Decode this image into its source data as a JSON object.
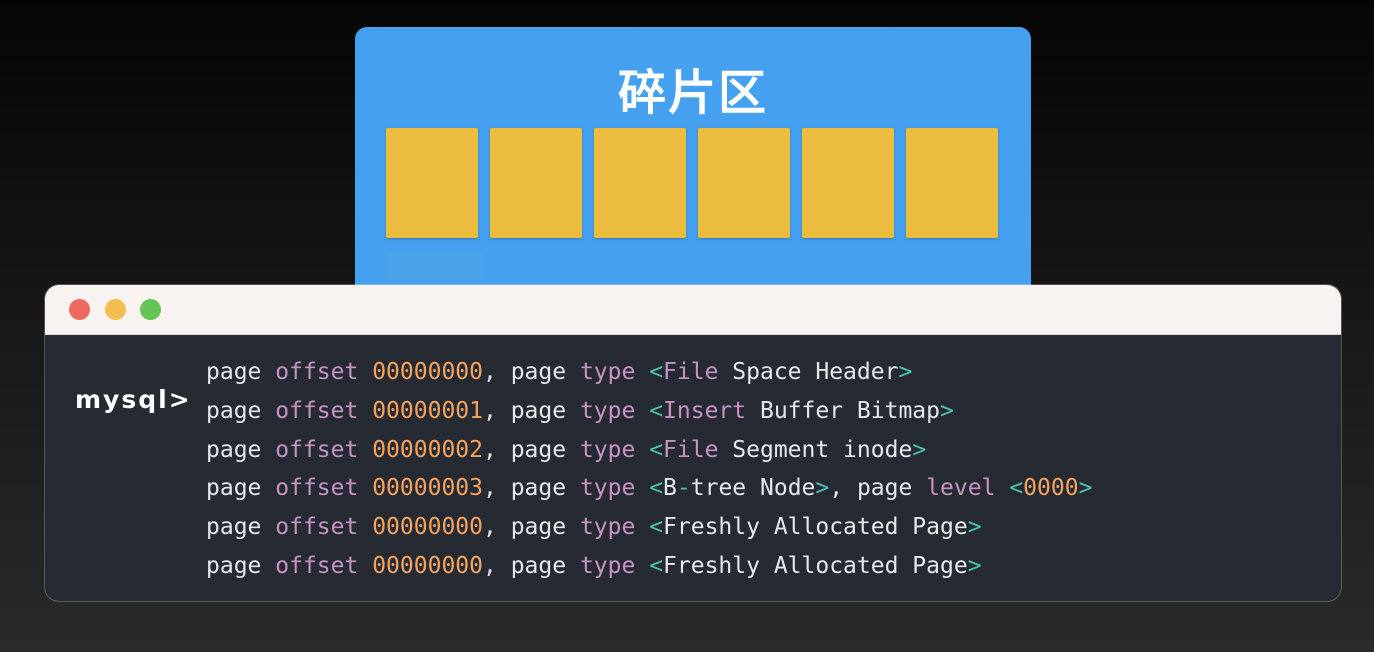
{
  "fragment_area": {
    "title": "碎片区",
    "block_count": 6,
    "colors": {
      "card": "#45a0f0",
      "block": "#ecbc3f"
    }
  },
  "terminal": {
    "window_controls": [
      "close",
      "minimize",
      "maximize"
    ],
    "prompt": "mysql>",
    "lines": [
      {
        "w_page": "page",
        "w_offset": "offset",
        "offset": "00000000",
        "sep": ", ",
        "w_page2": "page",
        "w_type": "type",
        "lt": "<",
        "t1": "File",
        "t2": " Space Header",
        "gt": ">"
      },
      {
        "w_page": "page",
        "w_offset": "offset",
        "offset": "00000001",
        "sep": ", ",
        "w_page2": "page",
        "w_type": "type",
        "lt": "<",
        "t1": "Insert",
        "t2": " Buffer Bitmap",
        "gt": ">"
      },
      {
        "w_page": "page",
        "w_offset": "offset",
        "offset": "00000002",
        "sep": ", ",
        "w_page2": "page",
        "w_type": "type",
        "lt": "<",
        "t1": "File",
        "t2": " Segment inode",
        "gt": ">"
      },
      {
        "w_page": "page",
        "w_offset": "offset",
        "offset": "00000003",
        "sep": ", ",
        "w_page2": "page",
        "w_type": "type",
        "lt": "<",
        "t1": "B",
        "dash": "-",
        "t2": "tree Node",
        "gt": ">",
        "sep2": ", ",
        "w_page3": "page",
        "w_level": "level",
        "lt2": "<",
        "level": "0000",
        "gt2": ">"
      },
      {
        "w_page": "page",
        "w_offset": "offset",
        "offset": "00000000",
        "sep": ", ",
        "w_page2": "page",
        "w_type": "type",
        "lt": "<",
        "t1": "Freshly Allocated Page",
        "t2": "",
        "gt": ">"
      },
      {
        "w_page": "page",
        "w_offset": "offset",
        "offset": "00000000",
        "sep": ", ",
        "w_page2": "page",
        "w_type": "type",
        "lt": "<",
        "t1": "Freshly Allocated Page",
        "t2": "",
        "gt": ">"
      }
    ],
    "colors": {
      "background": "#262b33",
      "keyword": "#c792c4",
      "number": "#f5a35f",
      "bracket": "#4ec2b4",
      "text": "#e6e8ec"
    }
  }
}
